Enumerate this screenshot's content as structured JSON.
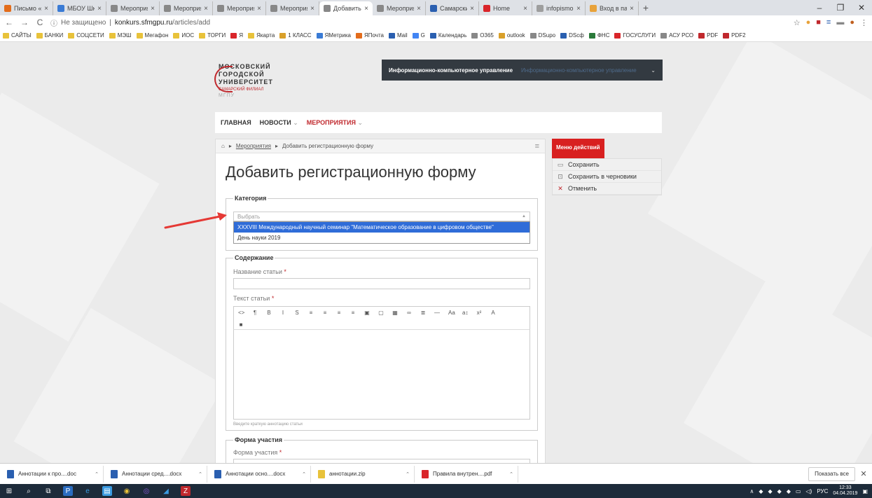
{
  "browser": {
    "tabs": [
      {
        "label": "Письмо «инф",
        "icon": "mail-icon",
        "color": "#e36c1b"
      },
      {
        "label": "МБОУ Школа",
        "icon": "school-icon",
        "color": "#3a7bd5"
      },
      {
        "label": "Мероприяти",
        "icon": "page-icon",
        "color": "#888888"
      },
      {
        "label": "Мероприяти",
        "icon": "page-icon",
        "color": "#888888"
      },
      {
        "label": "Мероприяти",
        "icon": "page-icon",
        "color": "#888888"
      },
      {
        "label": "Мероприяти",
        "icon": "page-icon",
        "color": "#888888"
      },
      {
        "label": "Добавить ре",
        "icon": "page-icon",
        "color": "#888888",
        "active": true
      },
      {
        "label": "Мероприяти",
        "icon": "page-icon",
        "color": "#888888"
      },
      {
        "label": "Самарский ф",
        "icon": "calendar-icon",
        "color": "#2a5fb0"
      },
      {
        "label": "Home",
        "icon": "home-icon",
        "color": "#d9252a"
      },
      {
        "label": "infopismo.pdf",
        "icon": "pdf-icon",
        "color": "#9e9e9e"
      },
      {
        "label": "Вход в панел",
        "icon": "login-icon",
        "color": "#e8a23a"
      }
    ],
    "new_tab": "+",
    "url_prefix": "Не защищено",
    "url_domain": "konkurs.sfmgpu.ru",
    "url_path": "/articles/add"
  },
  "bookmarks": [
    {
      "label": "САЙТЫ",
      "color": "#e8c23a"
    },
    {
      "label": "БАНКИ",
      "color": "#e8c23a"
    },
    {
      "label": "СОЦСЕТИ",
      "color": "#e8c23a"
    },
    {
      "label": "МЭШ",
      "color": "#e8c23a"
    },
    {
      "label": "Мегафон",
      "color": "#e8c23a"
    },
    {
      "label": "ИОС",
      "color": "#e8c23a"
    },
    {
      "label": "ТОРГИ",
      "color": "#e8c23a"
    },
    {
      "label": "Я",
      "color": "#d9252a"
    },
    {
      "label": "Якарта",
      "color": "#e8c23a"
    },
    {
      "label": "1 КЛАСС",
      "color": "#d9a02a"
    },
    {
      "label": "ЯМетрика",
      "color": "#3a7bd5"
    },
    {
      "label": "ЯПочта",
      "color": "#e36c1b"
    },
    {
      "label": "Mail",
      "color": "#2a5fb0"
    },
    {
      "label": "G",
      "color": "#4285f4"
    },
    {
      "label": "Календарь",
      "color": "#2a5fb0"
    },
    {
      "label": "O365",
      "color": "#888888"
    },
    {
      "label": "outlook",
      "color": "#d9a02a"
    },
    {
      "label": "DSupo",
      "color": "#888888"
    },
    {
      "label": "DScф",
      "color": "#2a5fb0"
    },
    {
      "label": "ФНС",
      "color": "#2a7a3a"
    },
    {
      "label": "ГОСУСЛУГИ",
      "color": "#d9252a"
    },
    {
      "label": "АСУ РСО",
      "color": "#888888"
    },
    {
      "label": "PDF",
      "color": "#c0282d"
    },
    {
      "label": "PDF2",
      "color": "#c0282d"
    }
  ],
  "site": {
    "logo": {
      "line1": "МОСКОВСКИЙ",
      "line2": "ГОРОДСКОЙ",
      "line3": "УНИВЕРСИТЕТ",
      "line4": "САМАРСКИЙ ФИЛИАЛ",
      "line5": "МГПУ"
    },
    "dept_selected": "Информационно-компьютерное управление",
    "dept_ghost": "Информационно-компьютерное управление",
    "menu": [
      {
        "label": "ГЛАВНАЯ",
        "chevron": ""
      },
      {
        "label": "НОВОСТИ",
        "chevron": "⌄"
      },
      {
        "label": "МЕРОПРИЯТИЯ",
        "chevron": "⌄",
        "active": true
      }
    ]
  },
  "breadcrumb": {
    "link": "Мероприятия",
    "current": "Добавить регистрационную форму"
  },
  "page_title": "Добавить регистрационную форму",
  "category": {
    "legend": "Категория",
    "placeholder": "Выбрать",
    "options": [
      "XXXVIII Международный научный семинар \"Математическое образование в цифровом обществе\"",
      "День науки 2019"
    ],
    "highlighted_index": 0
  },
  "content": {
    "legend": "Содержание",
    "title_label": "Название статьи",
    "text_label": "Текст статьи",
    "required_mark": "*",
    "toolbar_row1": [
      "<>",
      "¶",
      "B",
      "I",
      "S",
      "≡",
      "≡",
      "≡",
      "≡",
      "▣",
      "▢",
      "▦",
      "∞",
      "≣",
      "—",
      "Aa",
      "a↕",
      "x²",
      "A"
    ],
    "toolbar_row2": [
      "■"
    ],
    "hint": "Введите краткую аннотацию статьи"
  },
  "participation": {
    "legend": "Форма участия",
    "label": "Форма участия"
  },
  "sidebar": {
    "heading": "Меню действий",
    "items": [
      {
        "label": "Сохранить",
        "icon": "save-icon"
      },
      {
        "label": "Сохранить в черновики",
        "icon": "draft-icon"
      },
      {
        "label": "Отменить",
        "icon": "cancel-icon"
      }
    ]
  },
  "downloads": {
    "items": [
      {
        "name": "Аннотации к про....doc",
        "color": "#2a5fb0"
      },
      {
        "name": "Аннотации сред....docx",
        "color": "#2a5fb0"
      },
      {
        "name": "Аннотации осно....docx",
        "color": "#2a5fb0"
      },
      {
        "name": "аннотации.zip",
        "color": "#e8c23a"
      },
      {
        "name": "Правила внутрен....pdf",
        "color": "#d9252a"
      }
    ],
    "show_all": "Показать все"
  },
  "taskbar": {
    "lang": "РУС",
    "time": "12:33",
    "date": "04.04.2019"
  },
  "colors": {
    "brand": "#c0282d",
    "highlight": "#2f6cd8",
    "arrow": "#e53935"
  }
}
